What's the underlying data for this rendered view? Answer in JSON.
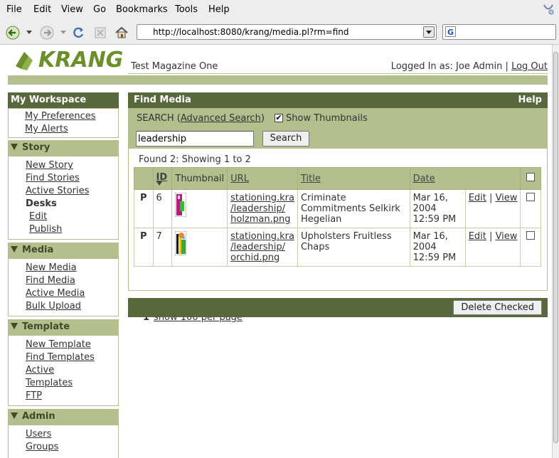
{
  "browser": {
    "menu": [
      "File",
      "Edit",
      "View",
      "Go",
      "Bookmarks",
      "Tools",
      "Help"
    ],
    "url": "http://localhost:8080/krang/media.pl?rm=find",
    "search_engine_glyph": "G"
  },
  "header": {
    "logo_text": "KRANG",
    "publication": "Test Magazine One",
    "logged_in_label": "Logged In as: Joe Admin",
    "separator": "|",
    "logout": "Log Out"
  },
  "sidebar": {
    "workspace_title": "My Workspace",
    "workspace_links": [
      "My Preferences",
      "My Alerts"
    ],
    "sections": [
      {
        "title": "Story",
        "links": [
          "New Story",
          "Find Stories",
          "Active Stories"
        ],
        "subhead": "Desks",
        "sublinks": [
          "Edit",
          "Publish"
        ]
      },
      {
        "title": "Media",
        "links": [
          "New Media",
          "Find Media",
          "Active Media",
          "Bulk Upload"
        ]
      },
      {
        "title": "Template",
        "links": [
          "New Template",
          "Find Templates",
          "Active",
          "Templates",
          "FTP"
        ]
      },
      {
        "title": "Admin",
        "links": [
          "Users",
          "Groups"
        ]
      }
    ]
  },
  "main": {
    "title": "Find Media",
    "help": "Help",
    "search_label": "SEARCH (",
    "advanced_search": "Advanced Search",
    "search_label_close": ")",
    "show_thumbnails_label": "Show Thumbnails",
    "show_thumbnails_checked": "✔",
    "search_value": "leadership",
    "search_button": "Search",
    "found_text": "Found 2: Showing 1 to 2",
    "columns": [
      "ID",
      "Thumbnail",
      "URL",
      "Title",
      "Date"
    ],
    "rows": [
      {
        "status": "P",
        "id": "6",
        "url": [
          "stationing.kra",
          "/leadership/",
          "holzman.png"
        ],
        "title": "Criminate Commitments Selkirk Hegelian",
        "date": "Mar 16, 2004 12:59 PM",
        "edit": "Edit",
        "sep": "|",
        "view": "View"
      },
      {
        "status": "P",
        "id": "7",
        "url": [
          "stationing.kra",
          "/leadership/",
          "orchid.png"
        ],
        "title": "Upholsters Fruitless Chaps",
        "date": "Mar 16, 2004 12:59 PM",
        "edit": "Edit",
        "sep": "|",
        "view": "View"
      }
    ],
    "pager_page": "1",
    "pager_link": "show 100 per page",
    "delete_button": "Delete Checked"
  },
  "colors": {
    "dark_green": "#57683c",
    "light_green": "#b4bf8e",
    "logo_green": "#6b8f2a"
  },
  "icons": [
    "back-arrow-icon",
    "forward-arrow-icon",
    "reload-icon",
    "stop-icon",
    "home-icon",
    "throbber-icon",
    "sort-desc-icon"
  ]
}
